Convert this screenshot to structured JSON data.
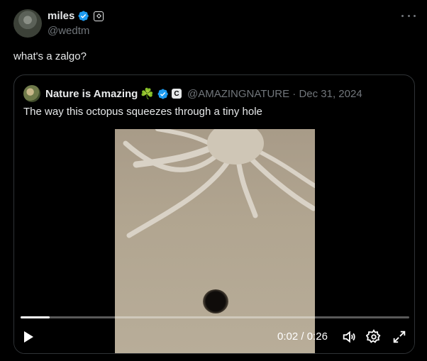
{
  "author": {
    "display_name": "miles",
    "handle": "@wedtm",
    "avatar_icon": "user-avatar"
  },
  "tweet": {
    "text": "what's a zalgo?"
  },
  "quoted": {
    "display_name": "Nature is Amazing",
    "emoji": "☘️",
    "badge": "C",
    "handle_date": "@AMAZINGNATURE · Dec 31, 2024",
    "text": "The way this octopus squeezes through a tiny hole"
  },
  "video": {
    "current_time": "0:02",
    "separator": "/",
    "duration": "0:26",
    "progress_fraction": 0.075
  },
  "colors": {
    "background": "#000000",
    "text": "#e7e9ea",
    "secondary_text": "#71767b",
    "verified_blue": "#1d9bf0",
    "border": "#2f3336"
  }
}
